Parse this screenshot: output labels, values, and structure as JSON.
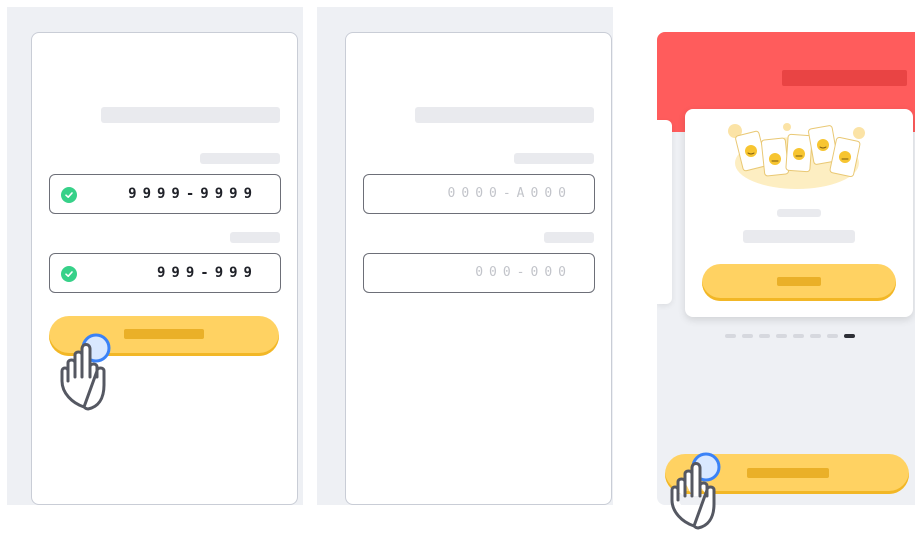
{
  "screens": [
    {
      "name": "join-form-filled",
      "fields": [
        {
          "value": "9999-9999",
          "validated": true
        },
        {
          "value": "999-999",
          "validated": true
        }
      ]
    },
    {
      "name": "join-form-empty",
      "fields": [
        {
          "placeholder": "0000-A000"
        },
        {
          "placeholder": "000-000"
        }
      ]
    },
    {
      "name": "onboarding-carousel",
      "pagination": {
        "total": 8,
        "active_index": 7
      }
    }
  ],
  "colors": {
    "accent_yellow": "#ffd262",
    "header_red": "#ff5c5c",
    "check_green": "#37d189",
    "tap_blue": "#3b82f6"
  },
  "icons": [
    "check-icon",
    "tap-hand-icon",
    "emoji-cards-illustration"
  ]
}
